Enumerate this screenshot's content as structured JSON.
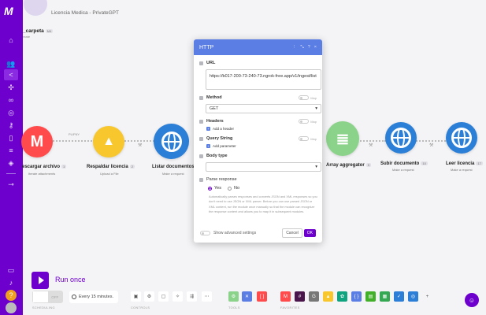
{
  "app": {
    "logo": "M",
    "breadcrumb": "Licencia Medica - PrivateGPT"
  },
  "scenario": {
    "name": "_carpeta",
    "badge": "M4",
    "sub": "reate"
  },
  "sidebar": {
    "icons": [
      "home-icon",
      "team-icon",
      "share-icon",
      "puzzle-icon",
      "link-icon",
      "globe-icon",
      "key-icon",
      "phone-icon",
      "database-icon",
      "cube-icon",
      "flow-icon",
      "book-icon",
      "bell-icon",
      "help-icon",
      "user-avatar-icon"
    ]
  },
  "nodes": [
    {
      "label": "escargar archivo",
      "badge": "1",
      "sub": "Iterate attachments",
      "color": "#ff4b4b",
      "glyph": "M"
    },
    {
      "label": "Respaldar licencia",
      "badge": "2",
      "sub": "Upload a File",
      "color": "#f8c72e",
      "glyph": "▲"
    },
    {
      "label": "Listar documentos",
      "badge": "3",
      "sub": "Make a request",
      "color": "#2c7fd7",
      "glyph": ""
    },
    {
      "label": "Array aggregator",
      "badge": "9",
      "sub": "",
      "color": "#8bd28a",
      "glyph": "≣"
    },
    {
      "label": "Subir documento",
      "badge": "10",
      "sub": "Make a request",
      "color": "#2c7fd7",
      "glyph": ""
    },
    {
      "label": "Leer licencia",
      "badge": "17",
      "sub": "Make a request",
      "color": "#2c7fd7",
      "glyph": ""
    }
  ],
  "filter_label": "PLIFNY",
  "modal": {
    "title": "HTTP",
    "header_actions": [
      "⋮",
      "⤡",
      "?",
      "×"
    ],
    "url_label": "URL",
    "url_value": "https://b017-200-73-240-73.ngrok-free.app/v1/ingest/list",
    "method_label": "Method",
    "method_value": "GET",
    "map_label": "Map",
    "headers_label": "Headers",
    "add_header": "Add a header",
    "query_label": "Query String",
    "add_param": "Add parameter",
    "body_label": "Body type",
    "body_value": "",
    "parse_label": "Parse response",
    "yes": "Yes",
    "no": "No",
    "help": "Automatically parses responses and converts JSON and XML responses so you don't need to use JSON or XML parser. Before you can use parsed JSON or XML content, run the module once manually so that the module can recognize the response content and allows you to map it in subsequent modules.",
    "advanced": "Show advanced settings",
    "cancel": "Cancel",
    "ok": "OK"
  },
  "bottom": {
    "run_once": "Run once",
    "off": "OFF",
    "schedule": "Every 15 minutes.",
    "cap_scheduling": "SCHEDULING",
    "cap_controls": "CONTROLS",
    "cap_tools": "TOOLS",
    "cap_favorites": "FAVORITES",
    "add": "+"
  }
}
